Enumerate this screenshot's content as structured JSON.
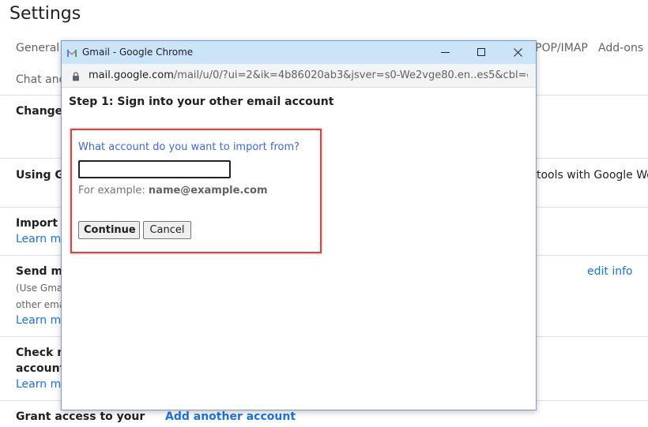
{
  "settings": {
    "title": "Settings",
    "tabs": {
      "general": "General",
      "pop_imap": "POP/IMAP",
      "addons": "Add-ons",
      "chat": "Chat and"
    },
    "rows": {
      "change": "Change",
      "using": "Using Gr",
      "using_right": "tools with Google Work",
      "import": "Import m",
      "import_link": "Learn mo",
      "send": "Send ma",
      "send_sub1": "(Use Gmail",
      "send_sub2": "other emai",
      "send_link": "Learn mo",
      "edit_info": "edit info",
      "check": "Check m",
      "check2": "accounts",
      "check_link": "Learn mo",
      "grant": "Grant access to your",
      "add_account": "Add another account"
    }
  },
  "popup": {
    "window_title": "Gmail - Google Chrome",
    "url_host": "mail.google.com",
    "url_path": "/mail/u/0/?ui=2&ik=4b86020ab3&jsver=s0-We2vge80.en..es5&cbl=g...",
    "step_heading": "Step 1: Sign into your other email account",
    "question": "What account do you want to import from?",
    "email_value": "",
    "example_prefix": "For example: ",
    "example_value": "name@example.com",
    "continue_label": "Continue",
    "cancel_label": "Cancel"
  },
  "colors": {
    "highlight": "#e0413d",
    "link": "#1a73e8",
    "titlebar": "#cce4f7"
  }
}
